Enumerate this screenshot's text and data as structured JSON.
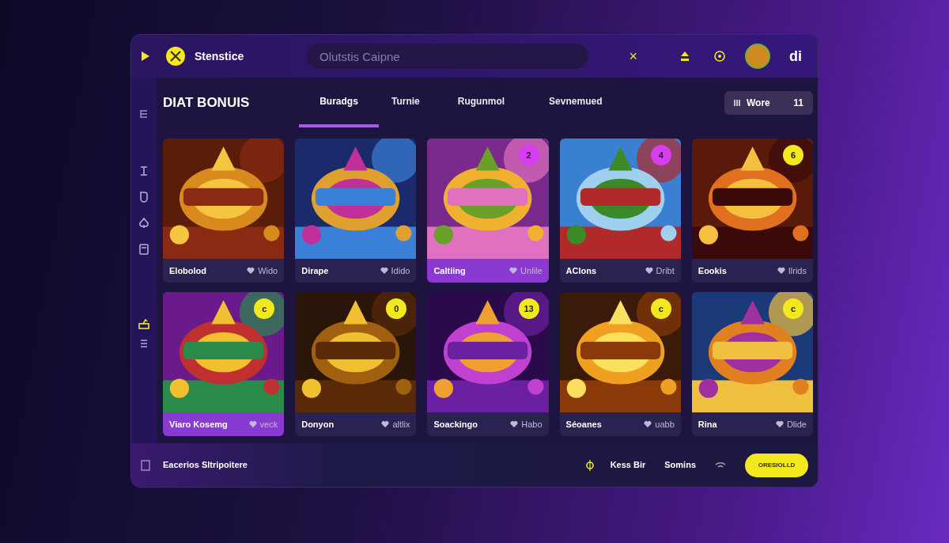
{
  "header": {
    "brand": "Stenstice",
    "search": {
      "placeholder": "Olutstis Caipne"
    },
    "close_glyph": "×",
    "user_short": "di"
  },
  "section": {
    "title": "DIAT BONUIS",
    "tabs": [
      {
        "label": "Buradgs",
        "selected": true
      },
      {
        "label": "Turnie",
        "selected": false
      },
      {
        "label": "Rugunmol",
        "selected": false
      },
      {
        "label": "Sevnemued",
        "selected": false
      }
    ],
    "filter": {
      "label": "Wore",
      "count": "11"
    }
  },
  "sidebar": {
    "items": [
      {
        "kind": "game",
        "selected": false
      },
      {
        "kind": "shield",
        "selected": false
      },
      {
        "kind": "spade",
        "selected": false
      },
      {
        "kind": "card",
        "selected": false
      },
      {
        "kind": "cash",
        "selected": true
      },
      {
        "kind": "menu",
        "selected": false
      }
    ]
  },
  "games": [
    {
      "name": "Elobolod",
      "meta": "Wido",
      "selected": false
    },
    {
      "name": "Dirape",
      "meta": "Idido",
      "selected": false
    },
    {
      "name": "Caltiing",
      "meta": "Unlile",
      "badge": "2",
      "color": "#d63df0",
      "selected": true
    },
    {
      "name": "AClons",
      "meta": "Dribt",
      "badge": "4",
      "color": "#d63df0",
      "selected": false
    },
    {
      "name": "Eookis",
      "meta": "Ilrids",
      "badge": "6",
      "color": "#f2e81e",
      "selected": false
    },
    {
      "name": "Viaro Kosemg",
      "meta": "veck",
      "badge": "c",
      "color": "#f2e81e",
      "selected": true
    },
    {
      "name": "Donyon",
      "meta": "altlix",
      "badge": "0",
      "color": "#f2e81e",
      "selected": false
    },
    {
      "name": "Soackingo",
      "meta": "Habo",
      "badge": "13",
      "color": "#f2e81e",
      "selected": false
    },
    {
      "name": "Séoanes",
      "meta": "uabb",
      "badge": "c",
      "color": "#f2e81e",
      "selected": false
    },
    {
      "name": "Rina",
      "meta": "Dlide",
      "badge": "c",
      "color": "#f2e81e",
      "selected": false
    }
  ],
  "footer": {
    "text": "Eacerios Sltripoitere",
    "link1": "Kess Bir",
    "link2": "Somins",
    "button": "ORESIOLLD"
  }
}
